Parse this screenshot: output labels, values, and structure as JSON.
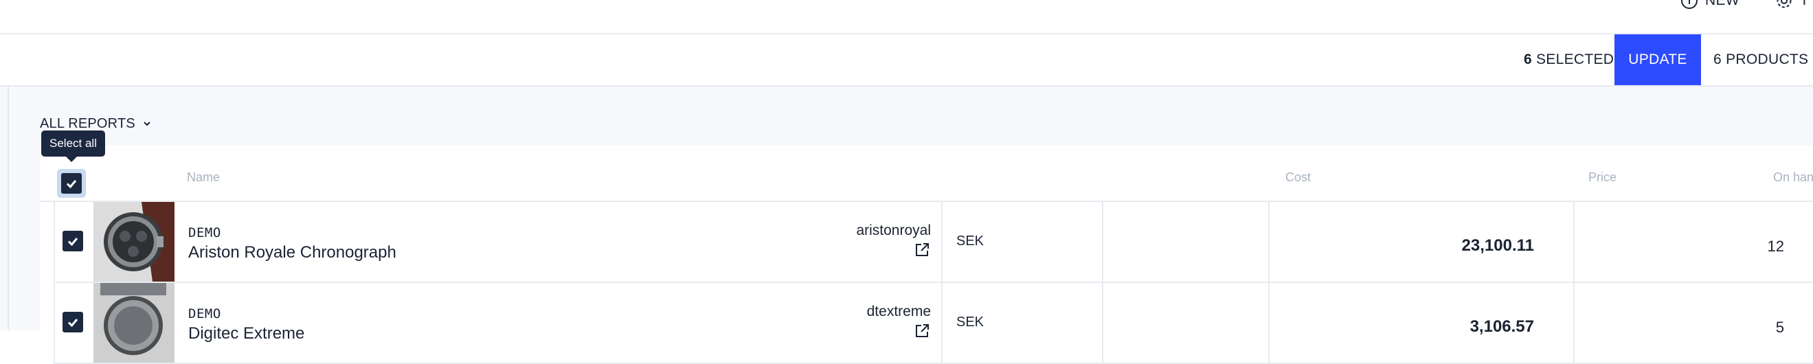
{
  "topbar": {
    "new_label": "NEW",
    "settings_label": "T",
    "new_icon": "info-circle-icon",
    "settings_icon": "gear-icon"
  },
  "actionbar": {
    "selected_count": "6",
    "selected_label": "SELECTED",
    "update_label": "UPDATE",
    "products_label": "6 PRODUCTS",
    "accent_color": "#2d4bff"
  },
  "filter": {
    "reports_label": "ALL REPORTS",
    "icon": "chevron-down-icon"
  },
  "table": {
    "select_all_tooltip": "Select all",
    "columns": {
      "name": "Name",
      "cost": "Cost",
      "price": "Price",
      "on_hand": "On hand"
    },
    "rows": [
      {
        "brand": "DEMO",
        "name": "Ariston Royale Chronograph",
        "sku": "aristonroyal",
        "currency": "SEK",
        "cost": "",
        "price": "23,100.11",
        "on_hand": "12",
        "checked": true
      },
      {
        "brand": "DEMO",
        "name": "Digitec Extreme",
        "sku": "dtextreme",
        "currency": "SEK",
        "cost": "",
        "price": "3,106.57",
        "on_hand": "5",
        "checked": true
      }
    ]
  }
}
